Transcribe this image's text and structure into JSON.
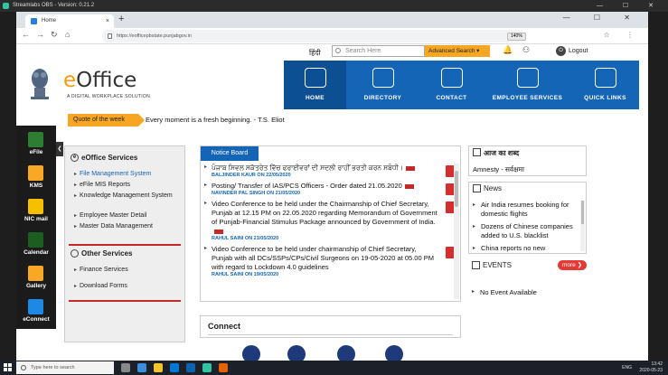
{
  "obs": {
    "title": "Streamlabs OBS - Version: 0.21.2",
    "controls": "— ☐ ✕"
  },
  "browser": {
    "tab_title": "Home",
    "tab_close": "×",
    "new_tab": "+",
    "window_controls": "— ☐ ✕",
    "url": "https://eofficepbstate.punjabgov.in",
    "zoom": "140%",
    "toolbar_icons": "☆ ⋮",
    "nav_back": "←",
    "nav_forward": "→",
    "nav_reload": "↻",
    "nav_home": "⌂"
  },
  "header": {
    "lang_link": "हिंदी",
    "search_placeholder": "Search Here",
    "advanced_search": "Advanced Search ▾",
    "logout": "Logout",
    "power_glyph": "⏻",
    "bell_glyph": "🔔",
    "user_glyph": "⚇"
  },
  "brand": {
    "logo_e": "e",
    "logo_rest": "Office",
    "tagline": "A DIGITAL WORKPLACE SOLUTION"
  },
  "nav": [
    {
      "label": "HOME",
      "active": true,
      "icon": "home-icon"
    },
    {
      "label": "DIRECTORY",
      "active": false,
      "icon": "directory-icon"
    },
    {
      "label": "CONTACT",
      "active": false,
      "icon": "contact-icon"
    },
    {
      "label": "EMPLOYEE SERVICES",
      "active": false,
      "icon": "employee-services-icon"
    },
    {
      "label": "QUICK LINKS",
      "active": false,
      "icon": "quick-links-icon"
    }
  ],
  "quote": {
    "label": "Quote of the week",
    "text": "Every moment is a fresh beginning. - T.S. Eliot"
  },
  "sidebar": [
    {
      "label": "eFile",
      "color": "#2e7d32"
    },
    {
      "label": "KMS",
      "color": "#f9a825"
    },
    {
      "label": "NIC mail",
      "color": "#f6c000"
    },
    {
      "label": "Calendar",
      "color": "#1b5e20"
    },
    {
      "label": "Gallery",
      "color": "#f9a825"
    },
    {
      "label": "eConnect",
      "color": "#1e88e5"
    }
  ],
  "sidebar_toggle": "❮",
  "services": {
    "eoffice_title": "eOffice Services",
    "eoffice_icon_glyph": "e",
    "eoffice_links": [
      "File Management System",
      "eFile MIS Reports",
      "Knowledge Management System",
      "Employee Master Detail",
      "Master Data Management"
    ],
    "other_title": "Other Services",
    "other_links": [
      "Finance Services",
      "Download Forms"
    ]
  },
  "notice": {
    "tab": "Notice Board",
    "items": [
      {
        "title": "ਪੰਜਾਬ ਸਿਵਲ ਸਕੱਤਰੇਤ ਵਿੱਚ ਫਰਾਈਵਰਾਂ ਦੀ ਸਦਲੀ ਰਾਹੀਂ ਭਰਤੀ ਕਰਨ ਸਬੰਧੀ।",
        "by": "BALJINDER KAUR ON 22/05/2020",
        "new": true
      },
      {
        "title": "Posting/ Transfer of IAS/PCS Officers - Order dated 21.05.2020",
        "by": "NAVINDER PAL SINGH ON 21/05/2020",
        "new": true
      },
      {
        "title": "Video Conference to be held under the Chairmanship of Chief Secretary, Punjab at 12.15 PM on 22.05.2020 regarding Memorandum of Government of Punjab-Financial Stimulus Package announced by Government of India.",
        "by": "RAHUL SAINI ON 21/05/2020",
        "new": true
      },
      {
        "title": "Video Conference to be held under chairmanship of Chief Secretary, Punjab with all DCs/SSPs/CPs/Civil Surgeons on 19-05-2020 at 05.00 PM with regard to Lockdown 4.0 guidelines",
        "by": "RAHUL SAINI ON 19/05/2020",
        "new": false
      }
    ]
  },
  "connect": {
    "title": "Connect"
  },
  "word": {
    "title": "आज का शब्द",
    "value": "Amnesty - सर्वक्षमा"
  },
  "news": {
    "title": "News",
    "items": [
      "Air India resumes booking for domestic flights",
      "Dozens of Chinese companies added to U.S. blacklist",
      "China reports no new coronavirus cases for first time"
    ]
  },
  "events": {
    "title": "EVENTS",
    "more": "more ❯",
    "items": [
      "No Event Available"
    ]
  },
  "taskbar": {
    "search_placeholder": "Type here to search",
    "lang": "ENG",
    "time": "13:42",
    "date": "2020-05-23"
  }
}
